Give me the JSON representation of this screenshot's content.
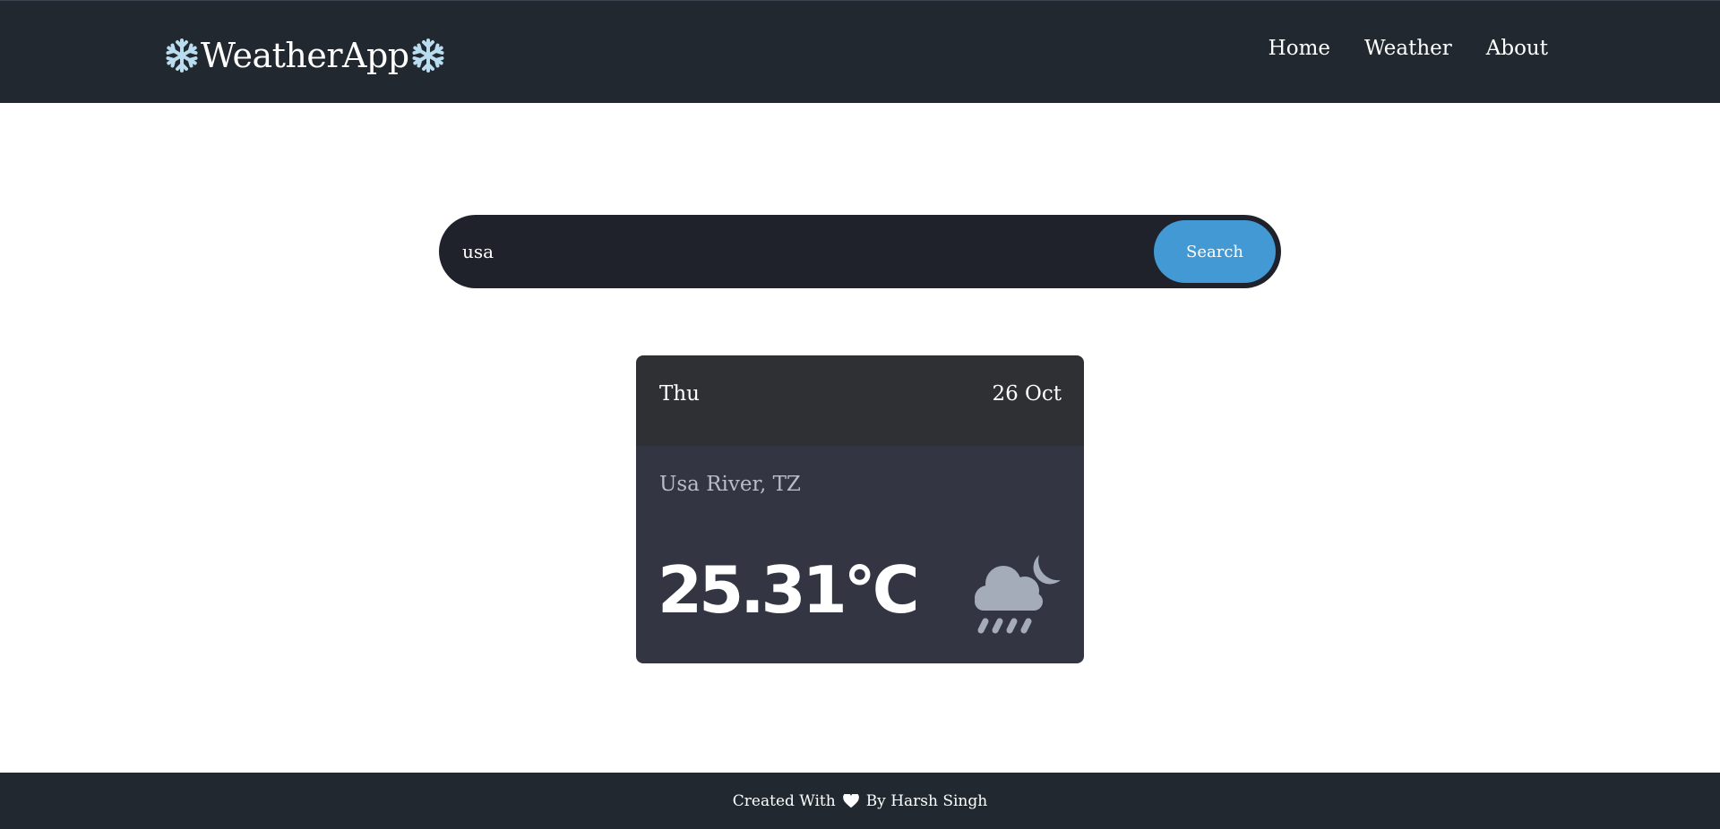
{
  "navbar": {
    "brand": "WeatherApp",
    "brand_icon": "snowflake-icon",
    "links": [
      {
        "label": "Home"
      },
      {
        "label": "Weather"
      },
      {
        "label": "About"
      }
    ]
  },
  "search": {
    "value": "usa",
    "button_label": "Search"
  },
  "card": {
    "day": "Thu",
    "date": "26 Oct",
    "location": "Usa River, TZ",
    "temperature": "25.31°C",
    "icon": "cloud-moon-rain-icon"
  },
  "footer": {
    "created_with": "Created With",
    "by": "By Harsh Singh",
    "icon": "heart-icon"
  },
  "colors": {
    "navbar_bg": "#212830",
    "search_bg": "#20222b",
    "accent": "#4299d4",
    "card_header_bg": "#2f3033",
    "card_body_bg": "#333642"
  }
}
